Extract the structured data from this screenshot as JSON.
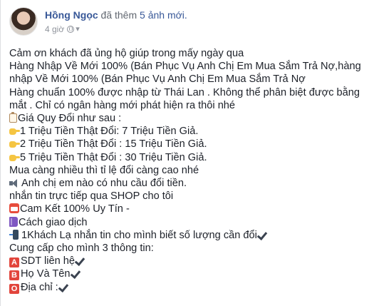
{
  "post": {
    "author": "Hồng Ngọc",
    "action_prefix": "đã thêm",
    "photos_link": "5 ảnh mới.",
    "timestamp": "4 giờ"
  },
  "body": {
    "lines": [
      {
        "icon": null,
        "text": "Cảm ơn khách đã ủng hộ giúp trong mấy ngày qua"
      },
      {
        "icon": null,
        "text": "Hàng Nhập Về Mới 100% (Bán Phục Vụ Anh Chị Em Mua Sắm Trả Nợ,hàng"
      },
      {
        "icon": null,
        "text": "nhập Về Mới 100% (Bán Phục Vụ Anh Chị Em Mua Sắm Trả Nợ"
      },
      {
        "icon": null,
        "text": "Hàng chuẩn 100% được nhập từ Thái Lan . Không thể phân biệt được bằng"
      },
      {
        "icon": null,
        "text": "mắt . Chỉ có ngân hàng mới phát hiện ra thôi nhé"
      },
      {
        "icon": "clipboard-icon",
        "text": "Giá Quy Đổi như sau :"
      },
      {
        "icon": "pointing-hand-icon",
        "text": "1 Triệu Tiền Thật Đổi: 7 Triệu Tiền Giả."
      },
      {
        "icon": "pointing-hand-icon",
        "text": "2 Triệu Tiền Thật Đổi : 15 Triệu Tiền Giả."
      },
      {
        "icon": "pointing-hand-icon",
        "text": "5 Triệu Tiền Thật Đổi : 30 Triệu Tiền Giả."
      },
      {
        "icon": null,
        "text": "Mua càng nhiều thì tỉ lệ đổi càng cao nhé"
      },
      {
        "icon": "speaker-icon",
        "text": "Anh chị em nào có nhu cầu đổi tiền."
      },
      {
        "icon": null,
        "text": "nhắn tin trực tiếp qua SHOP cho tôi"
      },
      {
        "icon": "calendar-icon",
        "text": "Cam Kết 100% Uy Tín -"
      },
      {
        "icon": "book-icon",
        "text": "Cách giao dịch"
      },
      {
        "icon": "phone-icon",
        "text": "1Khách Lạ nhắn tin cho mình biết số lượng cần đổi",
        "check": true
      },
      {
        "icon": null,
        "text": "Cung cấp cho mình 3 thông tin:"
      },
      {
        "icon": "letter-a-icon",
        "badge": "A",
        "text": "SDT liên hệ",
        "check": true
      },
      {
        "icon": "letter-b-icon",
        "badge": "B",
        "text": "Họ Và Tên",
        "check": true
      },
      {
        "icon": "letter-o-icon",
        "badge": "O",
        "text": "Địa chỉ :",
        "check": true
      }
    ]
  },
  "colors": {
    "author": "#385898",
    "meta": "#90949c",
    "text": "#1d2129",
    "badge": "#e2453c"
  }
}
